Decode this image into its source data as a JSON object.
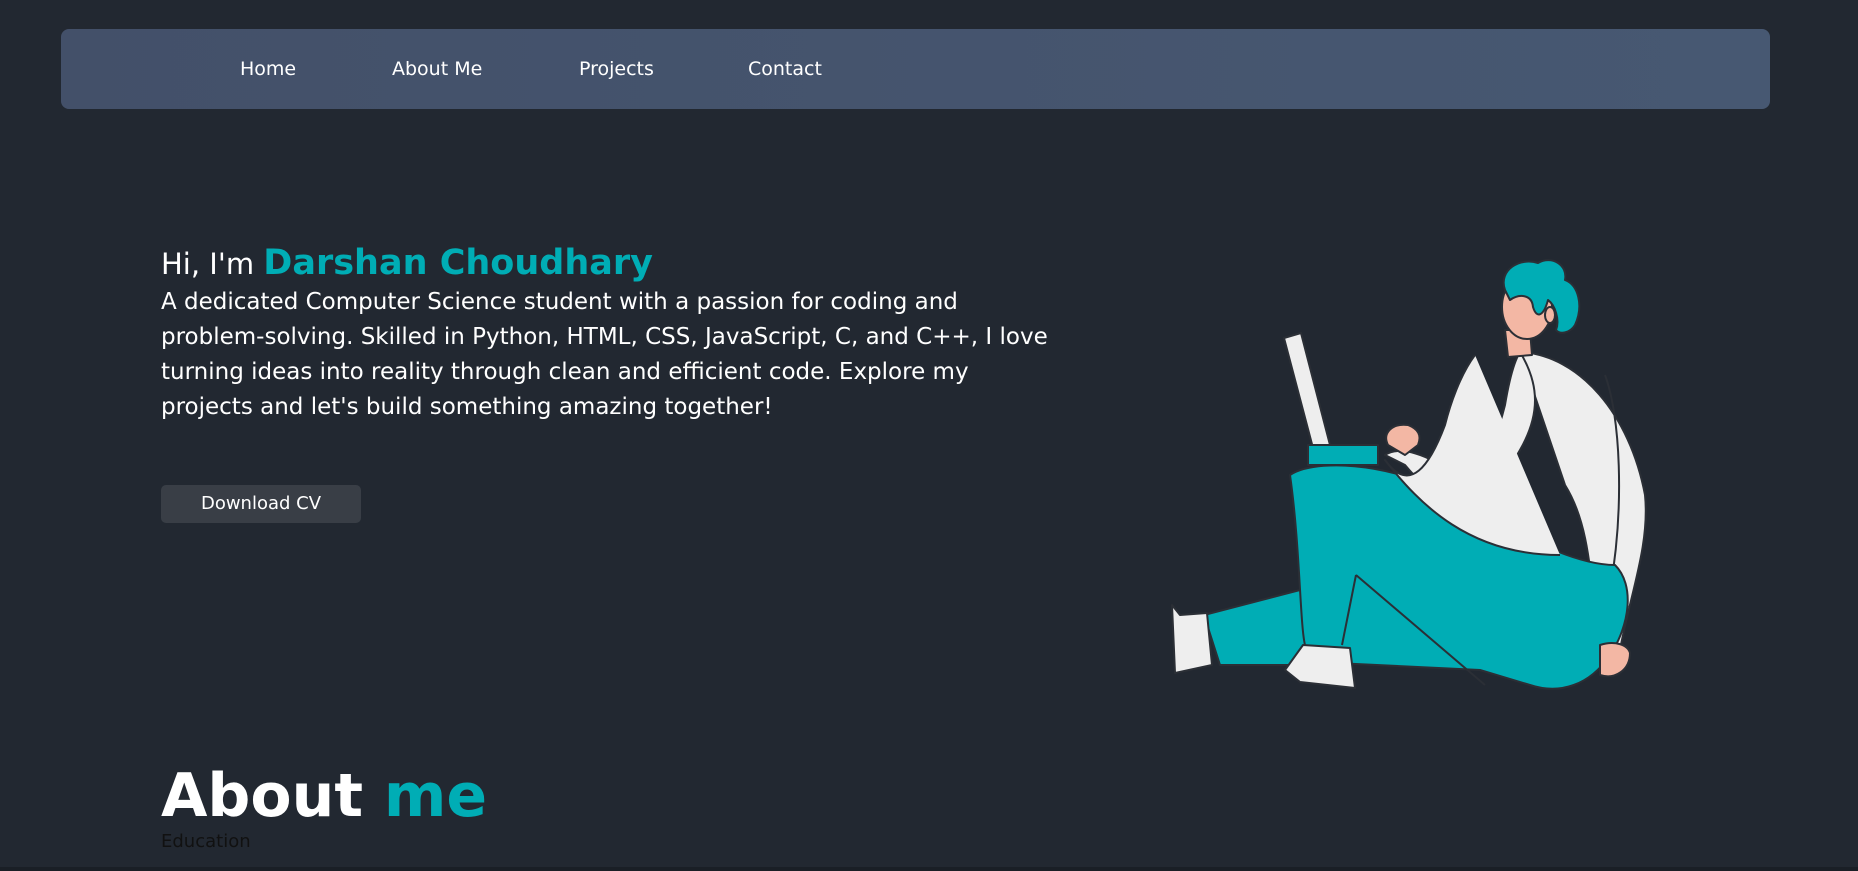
{
  "nav": {
    "items": [
      {
        "label": "Home"
      },
      {
        "label": "About Me"
      },
      {
        "label": "Projects"
      },
      {
        "label": "Contact"
      }
    ]
  },
  "hero": {
    "greeting": "Hi, I'm",
    "name": "Darshan Choudhary",
    "description": "A dedicated Computer Science student with a passion for coding and problem-solving. Skilled in Python, HTML, CSS, JavaScript, C, and C++, I love turning ideas into reality through clean and efficient code. Explore my projects and let's build something amazing together!",
    "cv_button": "Download CV"
  },
  "about": {
    "title_main": "About",
    "title_accent": "me",
    "subheading": "Education"
  },
  "colors": {
    "background": "#222831",
    "navbar": "#445570",
    "accent": "#00adb5",
    "button": "#393e46"
  },
  "icons": {
    "illustration": "person-with-laptop-illustration"
  }
}
